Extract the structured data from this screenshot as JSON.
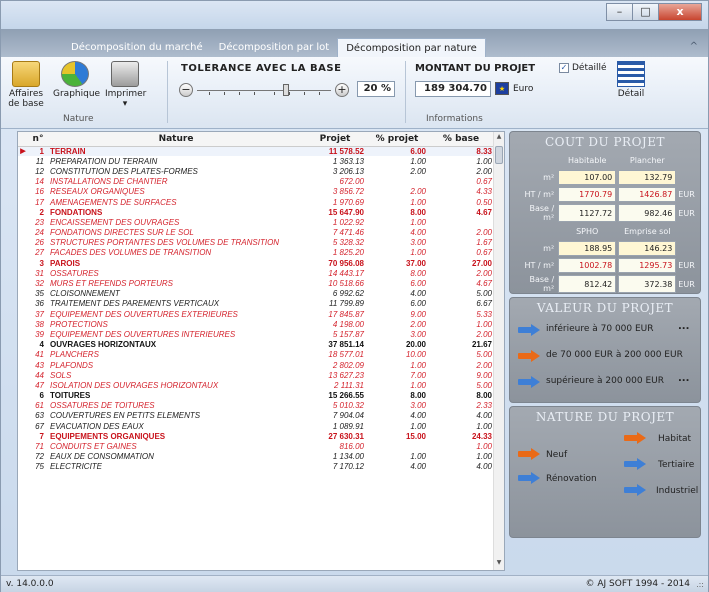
{
  "window": {
    "minimize": "–",
    "maximize": "□",
    "close": "x",
    "collapse_icon": "^"
  },
  "tabs": [
    {
      "label": "Décomposition du marché"
    },
    {
      "label": "Décomposition par lot"
    },
    {
      "label": "Décomposition par nature",
      "active": true
    }
  ],
  "ribbon": {
    "affaires_label": "Affaires de base",
    "graphique_label": "Graphique",
    "imprimer_label": "Imprimer",
    "imprimer_arrow": "▾",
    "nature_group": "Nature",
    "tolerance_title": "TOLERANCE AVEC LA BASE",
    "tolerance_value": "20 %",
    "tolerance_level_percent": 20,
    "minus": "−",
    "plus": "+",
    "montant_title": "MONTANT DU PROJET",
    "montant_value": "189 304.70",
    "currency": "Euro",
    "detaille_label": "Détaillé",
    "detaille_checked": "✓",
    "detail_label": "Détail",
    "informations_group": "Informations"
  },
  "table": {
    "headers": {
      "n": "n°",
      "nature": "Nature",
      "projet": "Projet",
      "pct_projet": "% projet",
      "pct_base": "% base"
    },
    "current_marker": "▶",
    "scroll_up": "▲",
    "scroll_down": "▼",
    "rows": [
      {
        "n": "1",
        "nature": "TERRAIN",
        "projet": "11 578.52",
        "pct_projet": "6.00",
        "pct_base": "8.33",
        "style": "group"
      },
      {
        "n": "11",
        "nature": "PREPARATION DU TERRAIN",
        "projet": "1 363.13",
        "pct_projet": "1.00",
        "pct_base": "1.00",
        "style": "black"
      },
      {
        "n": "12",
        "nature": "CONSTITUTION DES PLATES-FORMES",
        "projet": "3 206.13",
        "pct_projet": "2.00",
        "pct_base": "2.00",
        "style": "black"
      },
      {
        "n": "14",
        "nature": "INSTALLATIONS DE CHANTIER",
        "projet": "672.00",
        "pct_projet": "",
        "pct_base": "0.67",
        "style": "red"
      },
      {
        "n": "16",
        "nature": "RESEAUX ORGANIQUES",
        "projet": "3 856.72",
        "pct_projet": "2.00",
        "pct_base": "4.33",
        "style": "red"
      },
      {
        "n": "17",
        "nature": "AMENAGEMENTS DE SURFACES",
        "projet": "1 970.69",
        "pct_projet": "1.00",
        "pct_base": "0.50",
        "style": "red"
      },
      {
        "n": "2",
        "nature": "FONDATIONS",
        "projet": "15 647.90",
        "pct_projet": "8.00",
        "pct_base": "4.67",
        "style": "group"
      },
      {
        "n": "23",
        "nature": "ENCAISSEMENT DES OUVRAGES",
        "projet": "1 022.92",
        "pct_projet": "1.00",
        "pct_base": "",
        "style": "red"
      },
      {
        "n": "24",
        "nature": "FONDATIONS DIRECTES SUR LE SOL",
        "projet": "7 471.46",
        "pct_projet": "4.00",
        "pct_base": "2.00",
        "style": "red"
      },
      {
        "n": "26",
        "nature": "STRUCTURES PORTANTES DES VOLUMES DE TRANSITION",
        "projet": "5 328.32",
        "pct_projet": "3.00",
        "pct_base": "1.67",
        "style": "red"
      },
      {
        "n": "27",
        "nature": "FACADES DES VOLUMES DE TRANSITION",
        "projet": "1 825.20",
        "pct_projet": "1.00",
        "pct_base": "0.67",
        "style": "red"
      },
      {
        "n": "3",
        "nature": "PAROIS",
        "projet": "70 956.08",
        "pct_projet": "37.00",
        "pct_base": "27.00",
        "style": "group"
      },
      {
        "n": "31",
        "nature": "OSSATURES",
        "projet": "14 443.17",
        "pct_projet": "8.00",
        "pct_base": "2.00",
        "style": "red"
      },
      {
        "n": "32",
        "nature": "MURS ET REFENDS PORTEURS",
        "projet": "10 518.66",
        "pct_projet": "6.00",
        "pct_base": "4.67",
        "style": "red"
      },
      {
        "n": "35",
        "nature": "CLOISONNEMENT",
        "projet": "6 992.62",
        "pct_projet": "4.00",
        "pct_base": "5.00",
        "style": "black"
      },
      {
        "n": "36",
        "nature": "TRAITEMENT DES PAREMENTS VERTICAUX",
        "projet": "11 799.89",
        "pct_projet": "6.00",
        "pct_base": "6.67",
        "style": "black"
      },
      {
        "n": "37",
        "nature": "EQUIPEMENT DES OUVERTURES EXTERIEURES",
        "projet": "17 845.87",
        "pct_projet": "9.00",
        "pct_base": "5.33",
        "style": "red"
      },
      {
        "n": "38",
        "nature": "PROTECTIONS",
        "projet": "4 198.00",
        "pct_projet": "2.00",
        "pct_base": "1.00",
        "style": "red"
      },
      {
        "n": "39",
        "nature": "EQUIPEMENT DES OUVERTURES INTERIEURES",
        "projet": "5 157.87",
        "pct_projet": "3.00",
        "pct_base": "2.00",
        "style": "red"
      },
      {
        "n": "4",
        "nature": "OUVRAGES HORIZONTAUX",
        "projet": "37 851.14",
        "pct_projet": "20.00",
        "pct_base": "21.67",
        "style": "group-dark"
      },
      {
        "n": "41",
        "nature": "PLANCHERS",
        "projet": "18 577.01",
        "pct_projet": "10.00",
        "pct_base": "5.00",
        "style": "red"
      },
      {
        "n": "43",
        "nature": "PLAFONDS",
        "projet": "2 802.09",
        "pct_projet": "1.00",
        "pct_base": "2.00",
        "style": "red"
      },
      {
        "n": "44",
        "nature": "SOLS",
        "projet": "13 627.23",
        "pct_projet": "7.00",
        "pct_base": "9.00",
        "style": "red"
      },
      {
        "n": "47",
        "nature": "ISOLATION DES OUVRAGES HORIZONTAUX",
        "projet": "2 111.31",
        "pct_projet": "1.00",
        "pct_base": "5.00",
        "style": "red"
      },
      {
        "n": "6",
        "nature": "TOITURES",
        "projet": "15 266.55",
        "pct_projet": "8.00",
        "pct_base": "8.00",
        "style": "group-dark"
      },
      {
        "n": "61",
        "nature": "OSSATURES DE TOITURES",
        "projet": "5 010.32",
        "pct_projet": "3.00",
        "pct_base": "2.33",
        "style": "red"
      },
      {
        "n": "63",
        "nature": "COUVERTURES EN PETITS ELEMENTS",
        "projet": "7 904.04",
        "pct_projet": "4.00",
        "pct_base": "4.00",
        "style": "black"
      },
      {
        "n": "67",
        "nature": "EVACUATION DES EAUX",
        "projet": "1 089.91",
        "pct_projet": "1.00",
        "pct_base": "1.00",
        "style": "black"
      },
      {
        "n": "7",
        "nature": "EQUIPEMENTS ORGANIQUES",
        "projet": "27 630.31",
        "pct_projet": "15.00",
        "pct_base": "24.33",
        "style": "group"
      },
      {
        "n": "71",
        "nature": "CONDUITS ET GAINES",
        "projet": "816.00",
        "pct_projet": "",
        "pct_base": "1.00",
        "style": "red"
      },
      {
        "n": "72",
        "nature": "EAUX DE CONSOMMATION",
        "projet": "1 134.00",
        "pct_projet": "1.00",
        "pct_base": "1.00",
        "style": "black"
      },
      {
        "n": "75",
        "nature": "ELECTRICITE",
        "projet": "7 170.12",
        "pct_projet": "4.00",
        "pct_base": "4.00",
        "style": "black"
      }
    ]
  },
  "cout": {
    "title": "COUT DU PROJET",
    "col1": "Habitable",
    "col2": "Plancher",
    "rows1": [
      {
        "label": "m²",
        "v1": "107.00",
        "v2": "132.79",
        "unit": "",
        "red": false,
        "hl": true
      },
      {
        "label": "HT / m²",
        "v1": "1770.79",
        "v2": "1426.87",
        "unit": "EUR",
        "red": true,
        "hl": false
      },
      {
        "label": "Base / m²",
        "v1": "1127.72",
        "v2": "982.46",
        "unit": "EUR",
        "red": false,
        "hl": false
      }
    ],
    "col3": "SPHO",
    "col4": "Emprise sol",
    "rows2": [
      {
        "label": "m²",
        "v1": "188.95",
        "v2": "146.23",
        "unit": "",
        "red": false,
        "hl": true
      },
      {
        "label": "HT / m²",
        "v1": "1002.78",
        "v2": "1295.73",
        "unit": "EUR",
        "red": true,
        "hl": false
      },
      {
        "label": "Base / m²",
        "v1": "812.42",
        "v2": "372.38",
        "unit": "EUR",
        "red": false,
        "hl": false
      }
    ]
  },
  "valeur": {
    "title": "VALEUR DU PROJET",
    "opt1": "inférieure à 70 000 EUR",
    "opt2": "de 70 000 EUR à 200 000 EUR",
    "opt3": "supérieure à 200 000 EUR",
    "more": "..."
  },
  "nature": {
    "title": "NATURE DU PROJET",
    "neuf": "Neuf",
    "renovation": "Rénovation",
    "habitat": "Habitat",
    "tertiaire": "Tertiaire",
    "industriel": "Industriel"
  },
  "status": {
    "version": "v. 14.0.0.0",
    "copyright": "© AJ SOFT 1994 - 2014",
    "grip": ".::"
  },
  "colors": {
    "accent_red": "#c8121b",
    "arrow_blue": "#3e7fd6",
    "arrow_orange": "#ea6a17"
  }
}
